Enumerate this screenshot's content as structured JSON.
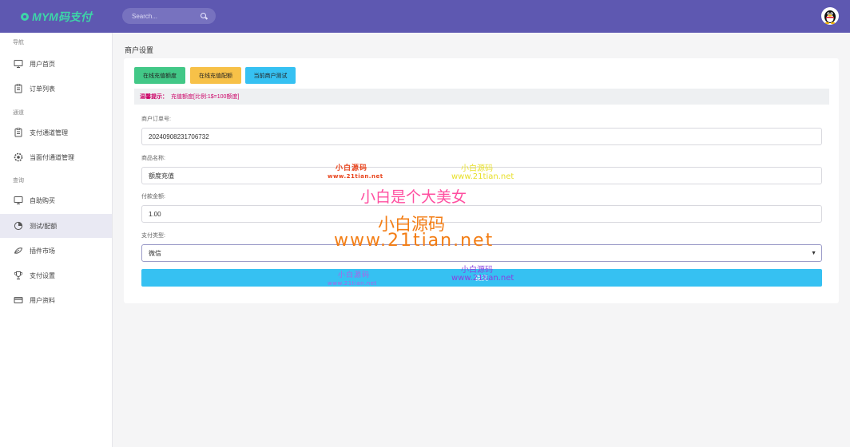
{
  "app": {
    "title": "MYM码支付"
  },
  "search": {
    "placeholder": "Search..."
  },
  "sidebar": {
    "sections": [
      "导航",
      "通道",
      "查询"
    ],
    "items": [
      {
        "label": "用户首页",
        "icon": "monitor-icon"
      },
      {
        "label": "订单列表",
        "icon": "clipboard-icon"
      },
      {
        "label": "支付通道管理",
        "icon": "clipboard-icon"
      },
      {
        "label": "当面付通道管理",
        "icon": "gear-icon"
      },
      {
        "label": "自助购买",
        "icon": "monitor-icon"
      },
      {
        "label": "测试/配额",
        "icon": "chart-icon",
        "active": true
      },
      {
        "label": "插件市场",
        "icon": "leaf-icon"
      },
      {
        "label": "支付设置",
        "icon": "trophy-icon"
      },
      {
        "label": "用户资料",
        "icon": "card-icon"
      }
    ]
  },
  "main": {
    "page_title": "商户设置",
    "buttons": {
      "recharge": "在线充值额度",
      "quota": "在线充值配额",
      "test": "当前商户测试"
    },
    "notice": {
      "prefix": "温馨提示：",
      "text": "充值额度[比例:1$=100额度]"
    },
    "form": {
      "order_no_label": "商户订单号:",
      "order_no_value": "20240908231706732",
      "product_label": "商品名称:",
      "product_value": "额度充值",
      "amount_label": "付款金额:",
      "amount_value": "1.00",
      "pay_type_label": "支付类型:",
      "pay_type_value": "微信",
      "submit_label": "提交"
    }
  },
  "watermarks": {
    "small_cn": "小白源码",
    "small_url": "www.21tian.net",
    "headline": "小白是个大美女",
    "big_cn": "小白源码",
    "big_url": "www.21tian.net"
  },
  "colors": {
    "topbar": "#5e58b1",
    "accent": "#3dd5a8",
    "green": "#42c887",
    "yellow": "#f7c148",
    "blue": "#36c1f2",
    "notice_text": "#cc0066"
  }
}
